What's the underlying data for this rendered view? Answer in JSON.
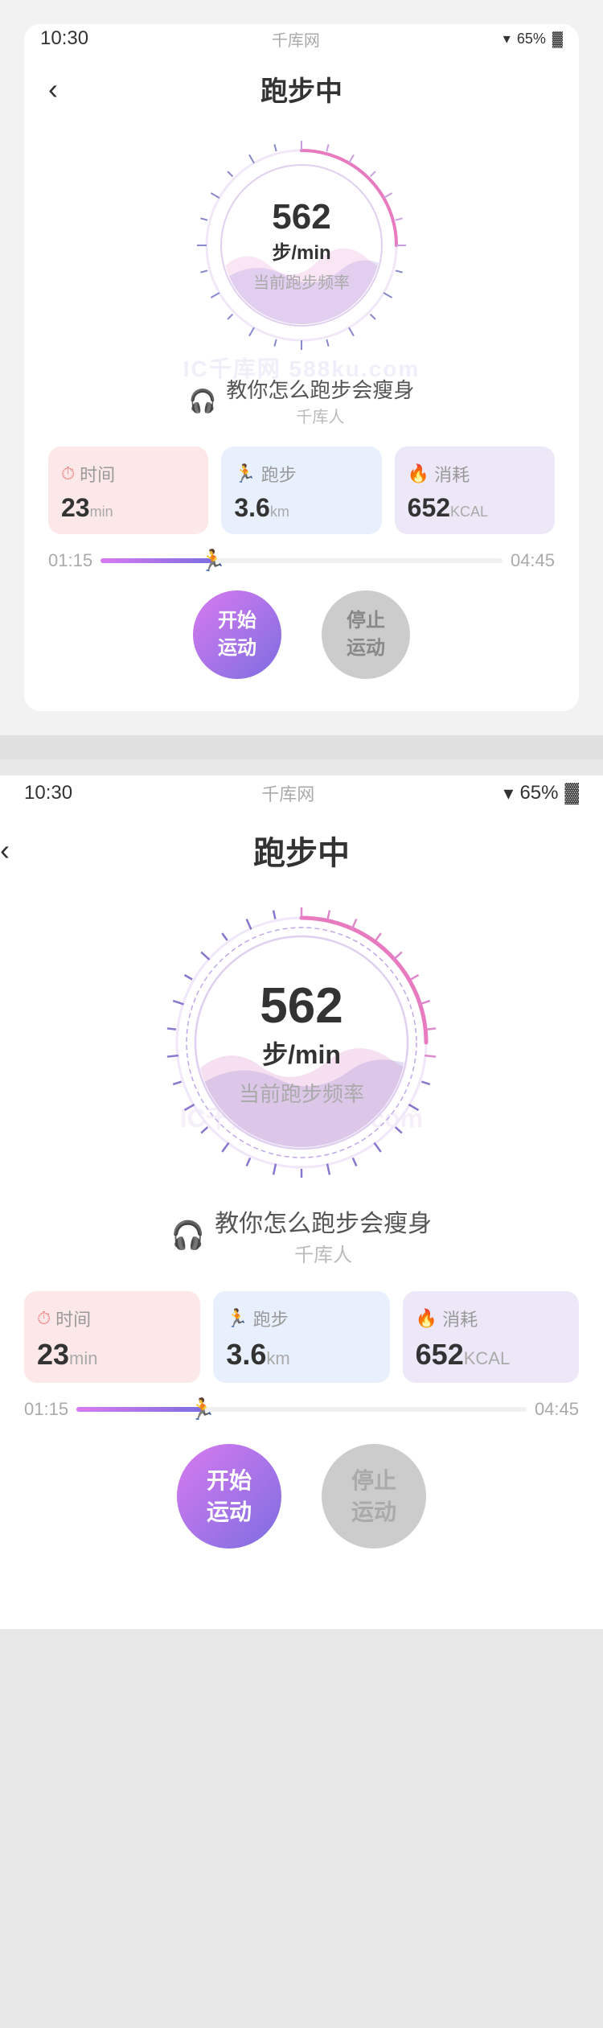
{
  "app": {
    "title": "跑步中",
    "back_label": "‹",
    "watermark": "IC千库网\n588ku.com"
  },
  "status_bar": {
    "time": "10:30",
    "network": "千库网",
    "wifi": "65%",
    "battery": "65%"
  },
  "speedometer": {
    "value": "562",
    "unit": "步/min",
    "label": "当前跑步频率"
  },
  "music": {
    "title": "教你怎么跑步会瘦身",
    "author": "千库人"
  },
  "stats": [
    {
      "icon": "⏱",
      "label": "时间",
      "value": "23",
      "unit": "min",
      "type": "time"
    },
    {
      "icon": "🏃",
      "label": "跑步",
      "value": "3.6",
      "unit": "km",
      "type": "run"
    },
    {
      "icon": "🔥",
      "label": "消耗",
      "value": "652",
      "unit": "KCAL",
      "type": "cal"
    }
  ],
  "progress": {
    "start": "01:15",
    "end": "04:45",
    "percent": 28
  },
  "buttons": {
    "start": "开始\n运动",
    "stop": "停止\n运动"
  },
  "colors": {
    "purple": "#7c6ee0",
    "pink": "#d87af0",
    "gradient_start": "#d87af0",
    "gradient_end": "#7c6ee0"
  }
}
